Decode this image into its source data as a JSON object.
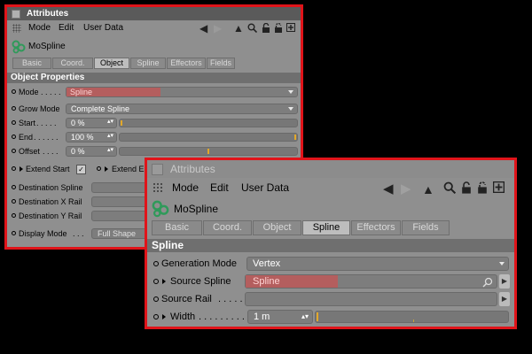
{
  "back_panel": {
    "title": "Attributes",
    "menu": [
      "Mode",
      "Edit",
      "User Data"
    ],
    "object_name": "MoSpline",
    "tabs": [
      "Basic",
      "Coord.",
      "Object",
      "Spline",
      "Effectors",
      "Fields"
    ],
    "active_tab": "Object",
    "section": "Object Properties",
    "mode": {
      "label": "Mode",
      "dots": ". . . . .",
      "value": "Spline"
    },
    "grow_mode": {
      "label": "Grow Mode",
      "value": "Complete Spline"
    },
    "start": {
      "label": "Start",
      "dots": ". . . . .",
      "value": "0 %",
      "fraction": 0.0
    },
    "end": {
      "label": "End",
      "dots": ". . . . . .",
      "value": "100 %",
      "fraction": 1.0
    },
    "offset": {
      "label": "Offset",
      "dots": ". . . .",
      "value": "0 %",
      "fraction": 0.5
    },
    "extend_start": {
      "label": "Extend Start",
      "checked": true
    },
    "extend_end": {
      "label": "Extend En"
    },
    "destination_spline": "Destination Spline",
    "destination_x_rail": "Destination X Rail",
    "destination_y_rail": "Destination Y Rail",
    "display_mode": {
      "label": "Display Mode",
      "dots": ". . .",
      "value": "Full Shape"
    }
  },
  "front_panel": {
    "title": "Attributes",
    "menu": [
      "Mode",
      "Edit",
      "User Data"
    ],
    "object_name": "MoSpline",
    "tabs": [
      "Basic",
      "Coord.",
      "Object",
      "Spline",
      "Effectors",
      "Fields"
    ],
    "active_tab": "Spline",
    "section": "Spline",
    "generation_mode": {
      "label": "Generation Mode",
      "value": "Vertex"
    },
    "source_spline": {
      "label": "Source Spline",
      "value": "Spline"
    },
    "source_rail": {
      "label": "Source Rail",
      "dots": ". . . . ."
    },
    "width": {
      "label": "Width",
      "dots": ". . . . . . . . . . . .",
      "value": "1 m"
    }
  },
  "colors": {
    "highlight": "#e0141a",
    "slider_knob": "#e2a82a"
  },
  "icons": [
    "grip-icon",
    "back-arrow-icon",
    "forward-arrow-icon",
    "up-arrow-icon",
    "search-icon",
    "lock-icon",
    "link-icon",
    "new-panel-icon",
    "mospline-icon"
  ]
}
